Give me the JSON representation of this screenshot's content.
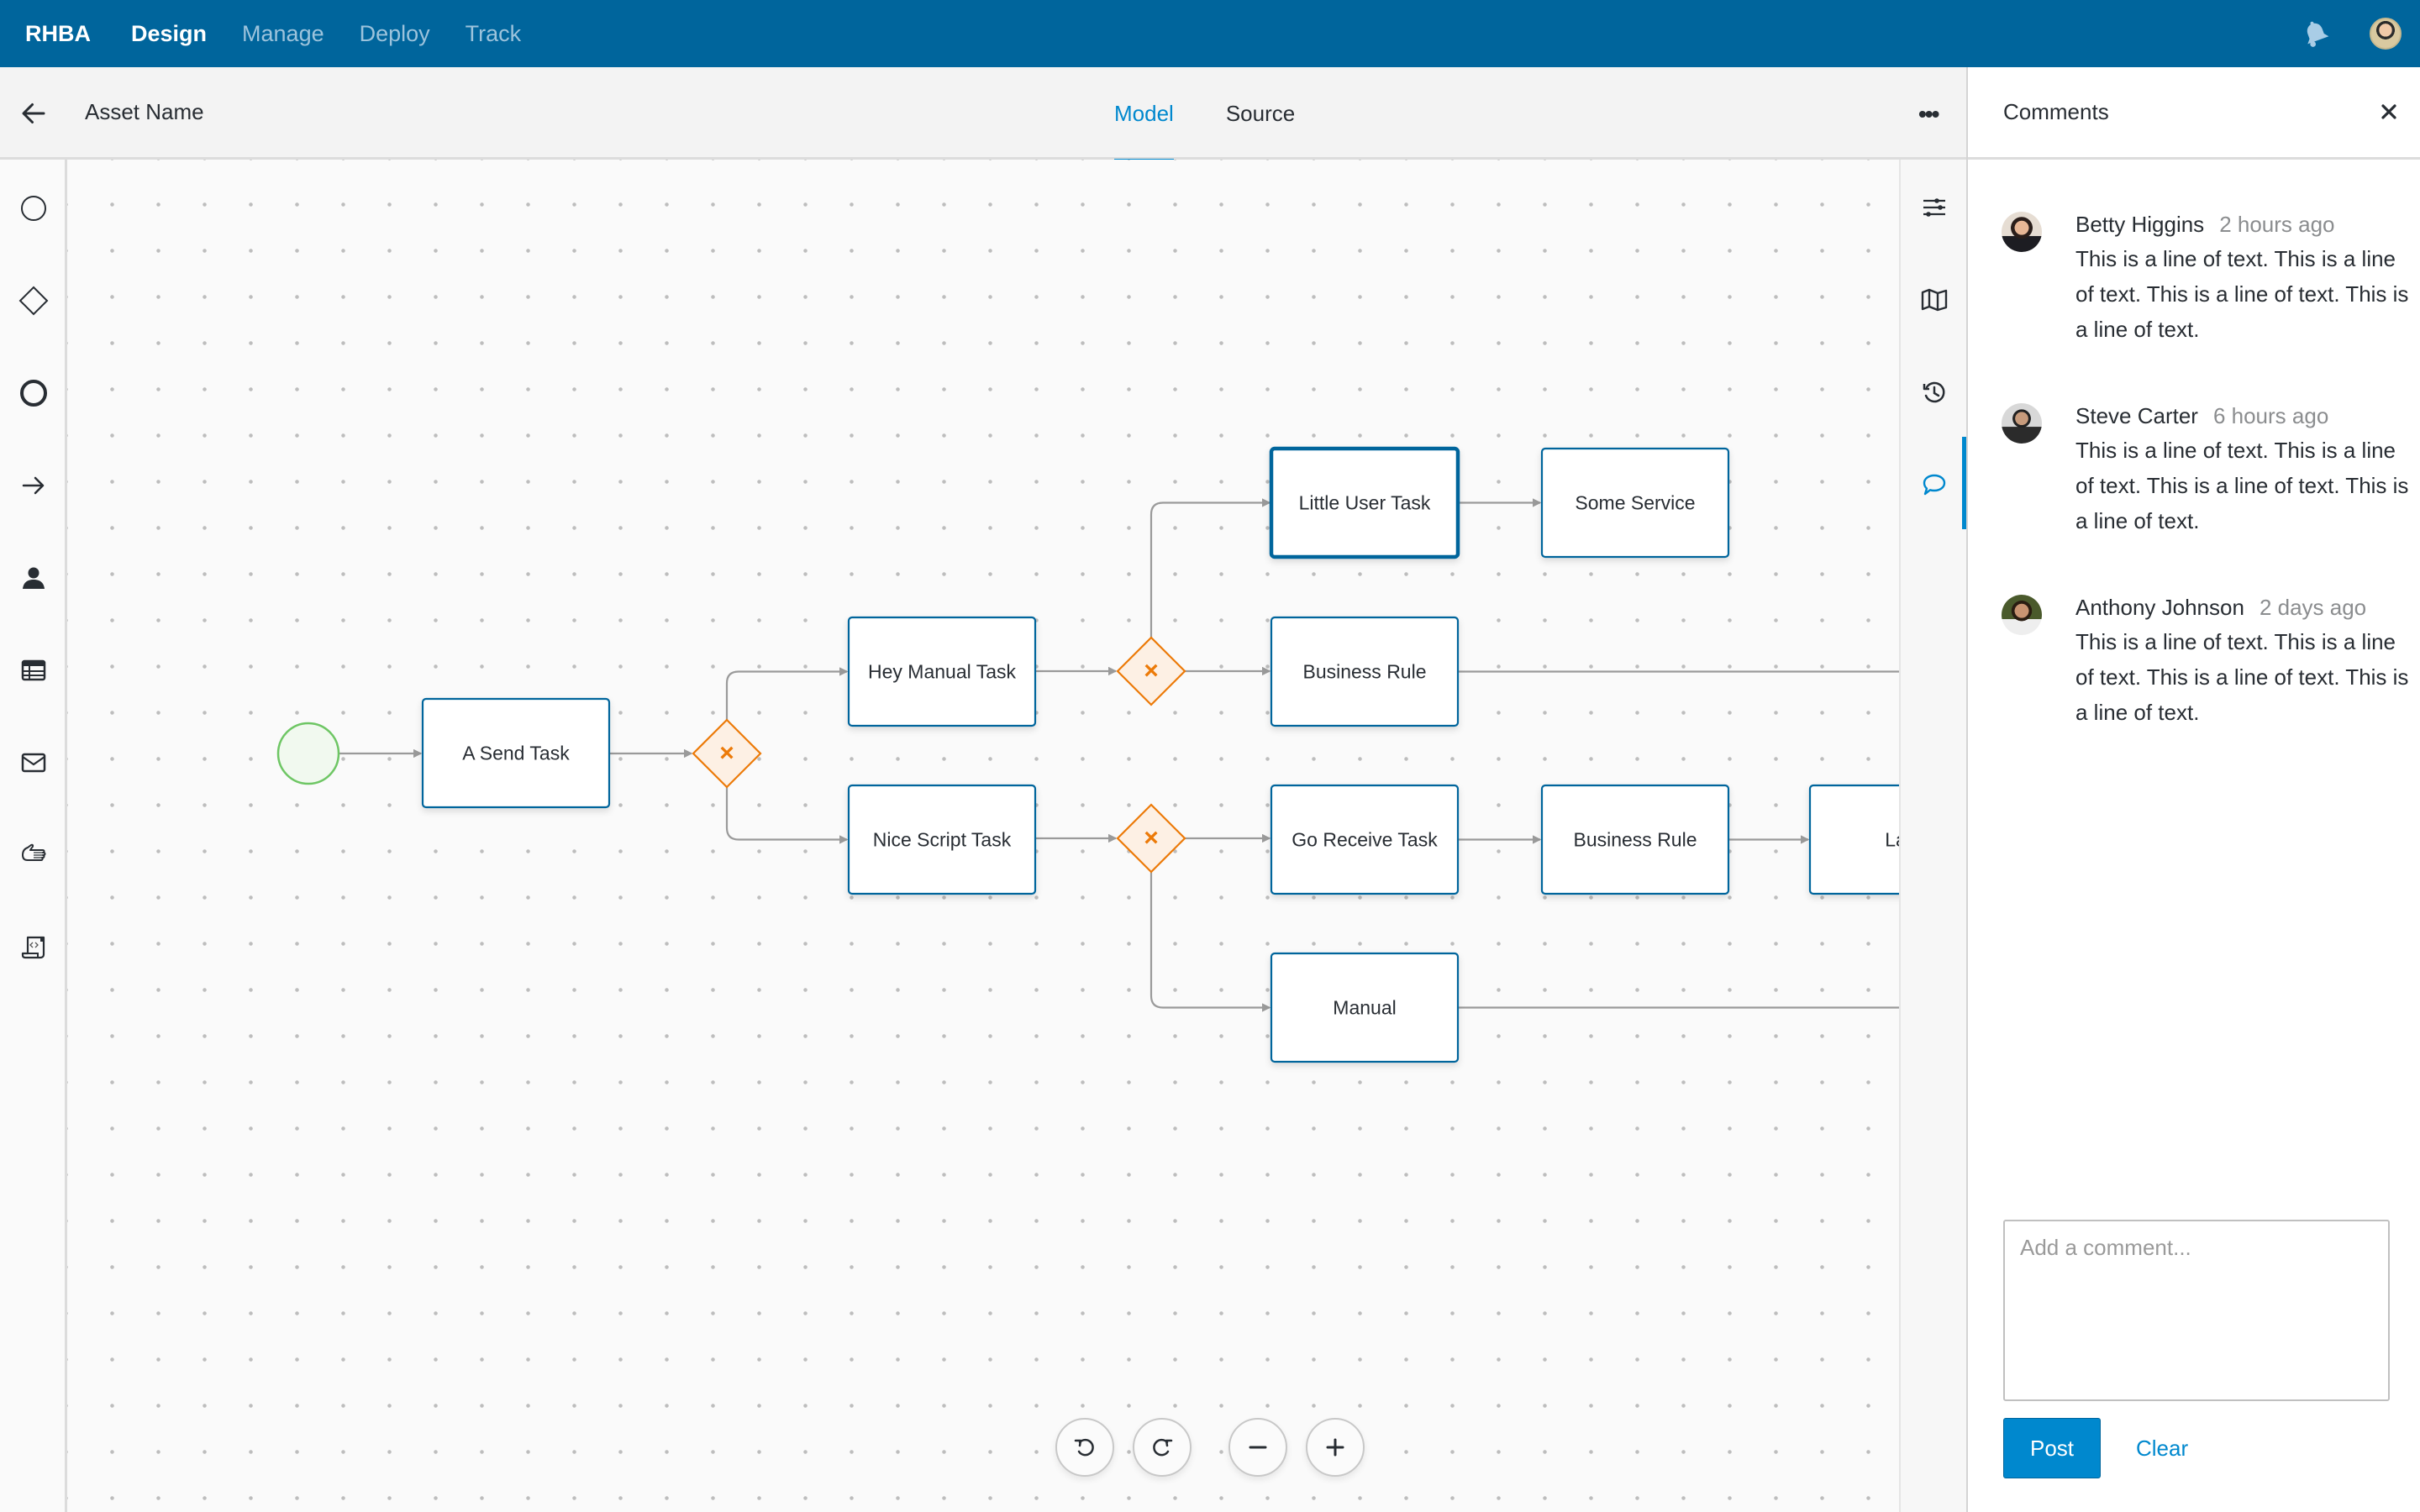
{
  "topbar": {
    "brand": "RHBA",
    "nav": [
      {
        "label": "Design",
        "active": true
      },
      {
        "label": "Manage",
        "active": false
      },
      {
        "label": "Deploy",
        "active": false
      },
      {
        "label": "Track",
        "active": false
      }
    ],
    "icons": [
      "bell-icon",
      "user-avatar"
    ]
  },
  "subheader": {
    "back_icon": "arrow-left-icon",
    "asset_name": "Asset Name",
    "tabs": [
      {
        "label": "Model",
        "active": true
      },
      {
        "label": "Source",
        "active": false
      }
    ],
    "more_label": "•••"
  },
  "left_toolbar": {
    "items": [
      {
        "name": "start-event",
        "icon": "circle-thin-icon"
      },
      {
        "name": "gateway",
        "icon": "diamond-icon"
      },
      {
        "name": "end-event",
        "icon": "circle-thick-icon"
      },
      {
        "name": "sequence-flow",
        "icon": "arrow-right-icon"
      },
      {
        "name": "user-task",
        "icon": "user-icon"
      },
      {
        "name": "business-rule-task",
        "icon": "table-icon"
      },
      {
        "name": "send-task",
        "icon": "envelope-icon"
      },
      {
        "name": "manual-task",
        "icon": "hand-icon"
      },
      {
        "name": "script-task",
        "icon": "script-icon"
      }
    ]
  },
  "right_toolbar": {
    "items": [
      {
        "name": "properties",
        "icon": "sliders-icon",
        "active": false
      },
      {
        "name": "overview-map",
        "icon": "map-icon",
        "active": false
      },
      {
        "name": "history",
        "icon": "history-icon",
        "active": false
      },
      {
        "name": "comments",
        "icon": "comment-icon",
        "active": true
      }
    ]
  },
  "diagram": {
    "start_event": {
      "label": ""
    },
    "tasks": [
      {
        "id": "send",
        "label": "A Send Task",
        "selected": false
      },
      {
        "id": "heymanual",
        "label": "Hey Manual Task",
        "selected": false
      },
      {
        "id": "nicescript",
        "label": "Nice Script Task",
        "selected": false
      },
      {
        "id": "littleuser",
        "label": "Little User Task",
        "selected": true
      },
      {
        "id": "someservice",
        "label": "Some Service",
        "selected": false
      },
      {
        "id": "businessrule1",
        "label": "Business Rule",
        "selected": false
      },
      {
        "id": "goreceive",
        "label": "Go Receive Task",
        "selected": false
      },
      {
        "id": "businessrule2",
        "label": "Business Rule",
        "selected": false
      },
      {
        "id": "last",
        "label": "Last",
        "selected": false
      },
      {
        "id": "manual",
        "label": "Manual",
        "selected": false
      }
    ],
    "gateways": [
      {
        "id": "gw1",
        "type": "exclusive",
        "symbol": "×"
      },
      {
        "id": "gw2",
        "type": "exclusive",
        "symbol": "×"
      },
      {
        "id": "gw3",
        "type": "exclusive",
        "symbol": "×"
      }
    ],
    "colors": {
      "task_border": "#00659c",
      "gateway": "#ec7a08",
      "start_event": "#6ec664",
      "flow": "#9a9a9a"
    }
  },
  "zoom_controls": [
    {
      "name": "undo",
      "icon": "undo-icon"
    },
    {
      "name": "redo",
      "icon": "redo-icon"
    },
    {
      "name": "zoom-out",
      "icon": "minus-icon"
    },
    {
      "name": "zoom-in",
      "icon": "plus-icon"
    }
  ],
  "comments_panel": {
    "title": "Comments",
    "close_icon": "close-icon",
    "comments": [
      {
        "author": "Betty Higgins",
        "time": "2 hours ago",
        "text": "This is a line of text. This is a line of text. This is a line of text. This is a line of text."
      },
      {
        "author": "Steve Carter",
        "time": "6 hours ago",
        "text": "This is a line of text. This is a line of text. This is a line of text. This is a line of text."
      },
      {
        "author": "Anthony Johnson",
        "time": "2 days ago",
        "text": "This is a line of text. This is a line of text. This is a line of text. This is a line of text."
      }
    ],
    "input_placeholder": "Add a comment...",
    "input_value": "",
    "post_label": "Post",
    "clear_label": "Clear"
  },
  "colors": {
    "brand_bar": "#00659c",
    "accent": "#0088ce"
  }
}
